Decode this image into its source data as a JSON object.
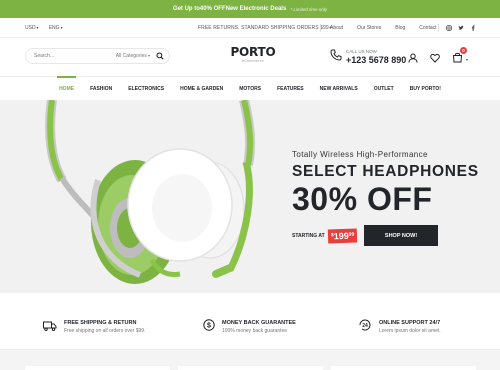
{
  "promo": {
    "text_before": "Get Up to ",
    "highlight": "40% OFF",
    "text_after": " New Electronic Deals",
    "fine_print": "* Limited time only"
  },
  "topbar": {
    "currency": "USD",
    "language": "ENG",
    "shipping": "FREE RETURNS. STANDARD SHIPPING ORDERS $99+",
    "links": [
      "About",
      "Our Stores",
      "Blog",
      "Contact"
    ],
    "social": [
      "instagram-icon",
      "twitter-icon",
      "facebook-icon"
    ]
  },
  "header": {
    "search_placeholder": "Search...",
    "category": "All Categories",
    "logo": "PORTO",
    "logo_sub": "eCommerce",
    "call_label": "CALL US NOW",
    "phone": "+123 5678 890",
    "cart_count": "0"
  },
  "nav": {
    "items": [
      "HOME",
      "FASHION",
      "ELECTRONICS",
      "HOME & GARDEN",
      "MOTORS",
      "FEATURES",
      "NEW ARRIVALS",
      "OUTLET",
      "BUY PORTO!"
    ],
    "active": 0
  },
  "hero": {
    "subtitle": "Totally Wireless High-Performance",
    "heading": "SELECT HEADPHONES",
    "big": "30% OFF",
    "starting": "STARTING AT",
    "price_currency": "$",
    "price_main": "199",
    "price_cents": "99",
    "button": "SHOP NOW!",
    "colors": {
      "accent": "#7cb342",
      "price_bg": "#e93e3e",
      "dark": "#222529"
    }
  },
  "features": [
    {
      "icon": "truck-icon",
      "title": "FREE SHIPPING & RETURN",
      "desc": "Free shipping on all orders over $99."
    },
    {
      "icon": "money-icon",
      "title": "MONEY BACK GUARANTEE",
      "desc": "100% money back guarantee"
    },
    {
      "icon": "support-24-icon",
      "title": "ONLINE SUPPORT 24/7",
      "desc": "Lorem ipsum dolor sit amet."
    }
  ]
}
